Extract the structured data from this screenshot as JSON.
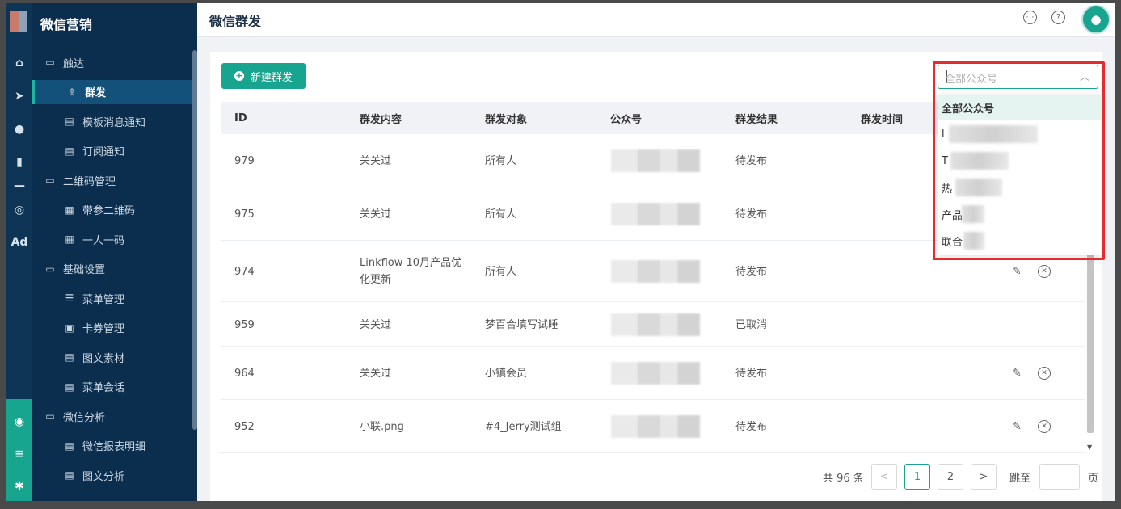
{
  "app": {
    "name": "微信营销",
    "page_title": "微信群发"
  },
  "rail": [
    {
      "icon": "home-icon",
      "glyph": "⌂"
    },
    {
      "icon": "send-icon",
      "glyph": "➤"
    },
    {
      "icon": "user-icon",
      "glyph": "●"
    },
    {
      "icon": "bar-chart-icon",
      "glyph": "▮"
    },
    {
      "icon": "divider-icon",
      "glyph": "—"
    },
    {
      "icon": "wechat-icon",
      "glyph": "◎"
    },
    {
      "icon": "ad-icon",
      "glyph": "Ad"
    }
  ],
  "rail_bottom": [
    {
      "icon": "analytics-icon",
      "glyph": "◉"
    },
    {
      "icon": "server-icon",
      "glyph": "≡"
    },
    {
      "icon": "settings-icon",
      "glyph": "✱"
    }
  ],
  "nav": [
    {
      "label": "触达",
      "type": "group",
      "icon": "folder-icon",
      "glyph": "▭"
    },
    {
      "label": "群发",
      "type": "child",
      "icon": "upload-icon",
      "glyph": "⇪",
      "active": true
    },
    {
      "label": "模板消息通知",
      "type": "child",
      "icon": "template-icon",
      "glyph": "▤"
    },
    {
      "label": "订阅通知",
      "type": "child",
      "icon": "subscribe-icon",
      "glyph": "▤"
    },
    {
      "label": "二维码管理",
      "type": "group",
      "icon": "folder-icon",
      "glyph": "▭"
    },
    {
      "label": "带参二维码",
      "type": "child",
      "icon": "qrcode-icon",
      "glyph": "▦"
    },
    {
      "label": "一人一码",
      "type": "child",
      "icon": "qrcode-icon",
      "glyph": "▦"
    },
    {
      "label": "基础设置",
      "type": "group",
      "icon": "folder-icon",
      "glyph": "▭"
    },
    {
      "label": "菜单管理",
      "type": "child",
      "icon": "list-icon",
      "glyph": "☰"
    },
    {
      "label": "卡券管理",
      "type": "child",
      "icon": "coupon-icon",
      "glyph": "▣"
    },
    {
      "label": "图文素材",
      "type": "child",
      "icon": "document-icon",
      "glyph": "▤"
    },
    {
      "label": "菜单会话",
      "type": "child",
      "icon": "chat-icon",
      "glyph": "▤"
    },
    {
      "label": "微信分析",
      "type": "group",
      "icon": "folder-icon",
      "glyph": "▭"
    },
    {
      "label": "微信报表明细",
      "type": "child",
      "icon": "report-icon",
      "glyph": "▤"
    },
    {
      "label": "图文分析",
      "type": "child",
      "icon": "report-icon",
      "glyph": "▤"
    }
  ],
  "toolbar": {
    "new_label": "新建群发"
  },
  "table": {
    "headers": [
      "ID",
      "群发内容",
      "群发对象",
      "公众号",
      "群发结果",
      "群发时间"
    ],
    "rows": [
      {
        "id": "979",
        "content": "关关过",
        "target": "所有人",
        "result": "待发布",
        "actions": false
      },
      {
        "id": "975",
        "content": "关关过",
        "target": "所有人",
        "result": "待发布",
        "actions": false
      },
      {
        "id": "974",
        "content": "Linkflow 10月产品优化更新",
        "target": "所有人",
        "result": "待发布",
        "actions": true
      },
      {
        "id": "959",
        "content": "关关过",
        "target": "梦百合填写试睡",
        "result": "已取消",
        "actions": false
      },
      {
        "id": "964",
        "content": "关关过",
        "target": "小镇会员",
        "result": "待发布",
        "actions": true
      },
      {
        "id": "952",
        "content": "小联.png",
        "target": "#4_Jerry测试组",
        "result": "待发布",
        "actions": true
      }
    ]
  },
  "pagination": {
    "total_label": "共 96 条",
    "prev": "<",
    "pages": [
      "1",
      "2"
    ],
    "current": "1",
    "next": ">",
    "jump_label": "跳至",
    "page_suffix": "页"
  },
  "filter": {
    "placeholder": "全部公众号",
    "options": [
      "全部公众号",
      "l",
      "T",
      "热",
      "产品",
      "联合"
    ]
  },
  "colors": {
    "accent": "#18a58f",
    "sidebar": "#0c2e4e",
    "highlight": "#e52b2b"
  }
}
